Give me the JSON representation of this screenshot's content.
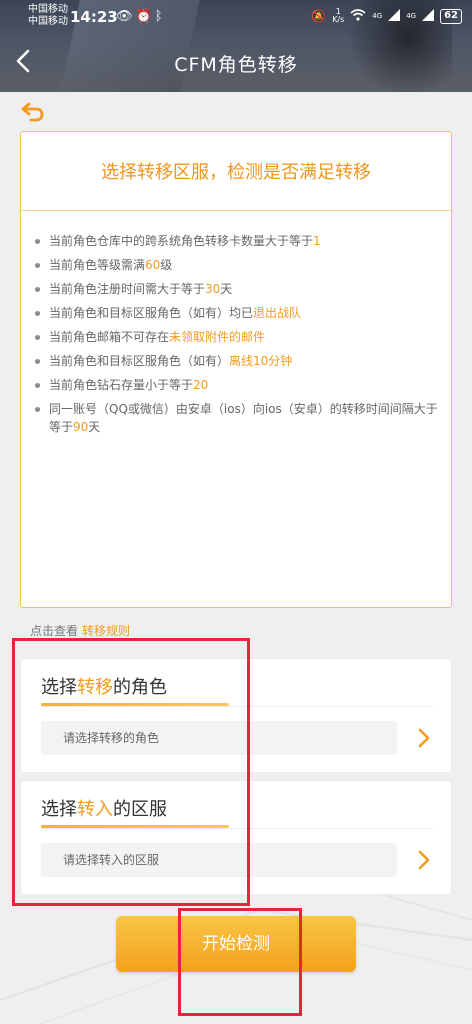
{
  "status_bar": {
    "carrier1": "中国移动",
    "carrier2": "中国移动",
    "time": "14:23",
    "speed_value": "1",
    "speed_unit": "K/s",
    "network1": "4G",
    "network2": "4G",
    "battery": "62"
  },
  "header": {
    "title": "CFM角色转移"
  },
  "info": {
    "title": "选择转移区服，检测是否满足转移",
    "rules": [
      {
        "pre": "当前角色仓库中的跨系统角色转移卡数量大于等于",
        "hl": "1",
        "post": ""
      },
      {
        "pre": "当前角色等级需满",
        "hl": "60",
        "post": "级"
      },
      {
        "pre": "当前角色注册时间需大于等于",
        "hl": "30",
        "post": "天"
      },
      {
        "pre": "当前角色和目标区服角色（如有）均已",
        "hl": "退出战队",
        "post": ""
      },
      {
        "pre": "当前角色邮箱不可存在",
        "hl": "未领取附件的邮件",
        "post": ""
      },
      {
        "pre": "当前角色和目标区服角色（如有）",
        "hl": "离线10分钟",
        "post": ""
      },
      {
        "pre": "当前角色钻石存量小于等于",
        "hl": "20",
        "post": ""
      },
      {
        "pre": "同一账号（QQ或微信）由安卓（ios）向ios（安卓）的转移时间间隔大于等于",
        "hl": "90",
        "post": "天"
      }
    ]
  },
  "rules_link": {
    "prefix": "点击查看",
    "link": "转移规则"
  },
  "role_select": {
    "title_pre": "选择",
    "title_hl": "转移",
    "title_post": "的角色",
    "placeholder": "请选择转移的角色"
  },
  "server_select": {
    "title_pre": "选择",
    "title_hl": "转入",
    "title_post": "的区服",
    "placeholder": "请选择转入的区服"
  },
  "start_button": {
    "label": "开始检测"
  },
  "colors": {
    "accent": "#f29a1f",
    "annotation": "#e8243d"
  }
}
